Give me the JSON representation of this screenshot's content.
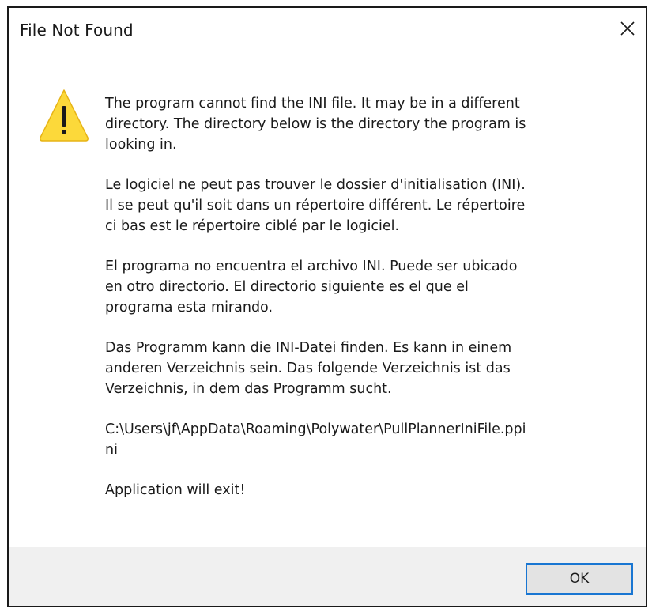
{
  "dialog": {
    "title": "File Not Found",
    "icon": "warning-icon",
    "paragraphs": {
      "english": "The program cannot find the INI file.  It may be in a different\ndirectory. The directory below is the directory the program is\nlooking in.",
      "french": "Le logiciel ne peut pas trouver le dossier d'initialisation (INI).\nIl se peut qu'il soit dans un répertoire différent.  Le répertoire\nci bas est le répertoire ciblé par le logiciel.",
      "spanish": "El programa no encuentra el archivo INI.  Puede ser ubicado\nen otro directorio.  El directorio siguiente es  el que el\nprograma esta mirando.",
      "german": "Das Programm kann die INI-Datei finden. Es kann in einem\nanderen Verzeichnis sein. Das folgende Verzeichnis ist das\nVerzeichnis, in dem das Programm sucht.",
      "path": "C:\\Users\\jf\\AppData\\Roaming\\Polywater\\PullPlannerIniFile.ppi\nni",
      "exit_message": "Application will exit!"
    },
    "ok_label": "OK"
  },
  "colors": {
    "warning_fill": "#fcd93a",
    "button_border": "#1976d2",
    "footer_bg": "#f0f0f0"
  }
}
